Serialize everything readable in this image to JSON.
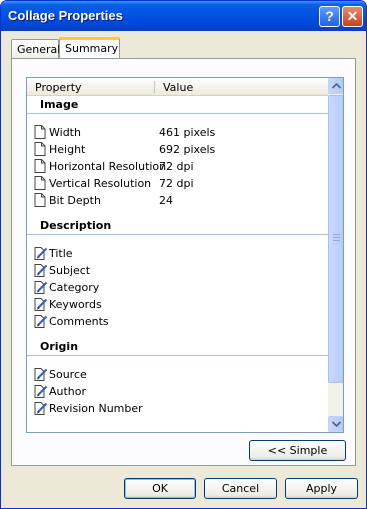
{
  "window": {
    "title": "Collage Properties",
    "help_label": "?",
    "close_label": "✕"
  },
  "tabs": [
    {
      "label": "General"
    },
    {
      "label": "Summary"
    }
  ],
  "list": {
    "columns": {
      "property": "Property",
      "value": "Value"
    },
    "sections": [
      {
        "title": "Image",
        "rows": [
          {
            "label": "Width",
            "value": "461 pixels",
            "icon": "document-icon"
          },
          {
            "label": "Height",
            "value": "692 pixels",
            "icon": "document-icon"
          },
          {
            "label": "Horizontal Resolution",
            "value": "72 dpi",
            "icon": "document-icon"
          },
          {
            "label": "Vertical Resolution",
            "value": "72 dpi",
            "icon": "document-icon"
          },
          {
            "label": "Bit Depth",
            "value": "24",
            "icon": "document-icon"
          }
        ]
      },
      {
        "title": "Description",
        "rows": [
          {
            "label": "Title",
            "value": "",
            "icon": "edit-document-icon"
          },
          {
            "label": "Subject",
            "value": "",
            "icon": "edit-document-icon"
          },
          {
            "label": "Category",
            "value": "",
            "icon": "edit-document-icon"
          },
          {
            "label": "Keywords",
            "value": "",
            "icon": "edit-document-icon"
          },
          {
            "label": "Comments",
            "value": "",
            "icon": "edit-document-icon"
          }
        ]
      },
      {
        "title": "Origin",
        "rows": [
          {
            "label": "Source",
            "value": "",
            "icon": "edit-document-icon"
          },
          {
            "label": "Author",
            "value": "",
            "icon": "edit-document-icon"
          },
          {
            "label": "Revision Number",
            "value": "",
            "icon": "edit-document-icon"
          }
        ]
      }
    ]
  },
  "buttons": {
    "simple": "<< Simple",
    "ok": "OK",
    "cancel": "Cancel",
    "apply": "Apply"
  },
  "colors": {
    "title_bar": "#0055e5",
    "accent_tab": "#ffc83c",
    "dialog_bg": "#ece9d8"
  }
}
